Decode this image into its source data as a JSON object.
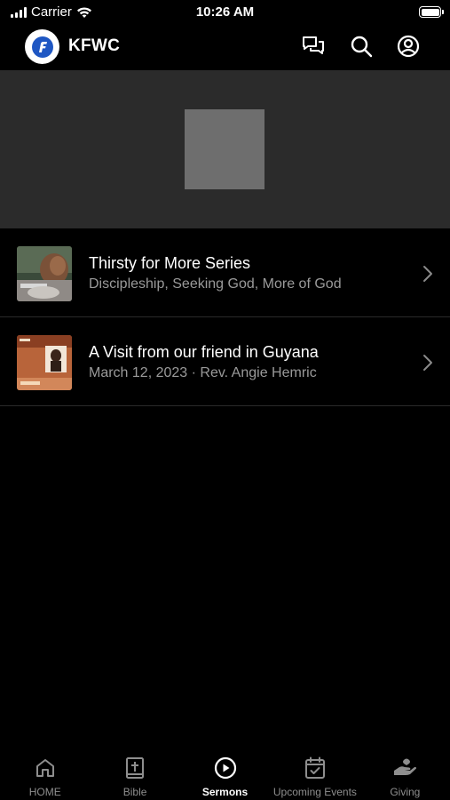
{
  "status_bar": {
    "carrier": "Carrier",
    "time": "10:26 AM"
  },
  "header": {
    "title": "KFWC",
    "icons": [
      "chat-icon",
      "search-icon",
      "account-icon"
    ]
  },
  "sermons": [
    {
      "title": "Thirsty for More Series",
      "subtitle": "Discipleship, Seeking God, More of God"
    },
    {
      "title": "A Visit from our friend in Guyana",
      "subtitle": "March 12, 2023 · Rev. Angie Hemric"
    }
  ],
  "tabs": [
    {
      "label": "HOME",
      "icon": "home-icon",
      "active": false
    },
    {
      "label": "Bible",
      "icon": "bible-icon",
      "active": false
    },
    {
      "label": "Sermons",
      "icon": "play-circle-icon",
      "active": true
    },
    {
      "label": "Upcoming Events",
      "icon": "calendar-check-icon",
      "active": false
    },
    {
      "label": "Giving",
      "icon": "giving-hand-icon",
      "active": false
    }
  ],
  "colors": {
    "background": "#000000",
    "hero_background": "#2b2b2b",
    "placeholder": "#6e6e6e",
    "subtitle_text": "#9a9a9a",
    "inactive_tab": "#8e8e8e",
    "logo_blue": "#1f57c3"
  }
}
